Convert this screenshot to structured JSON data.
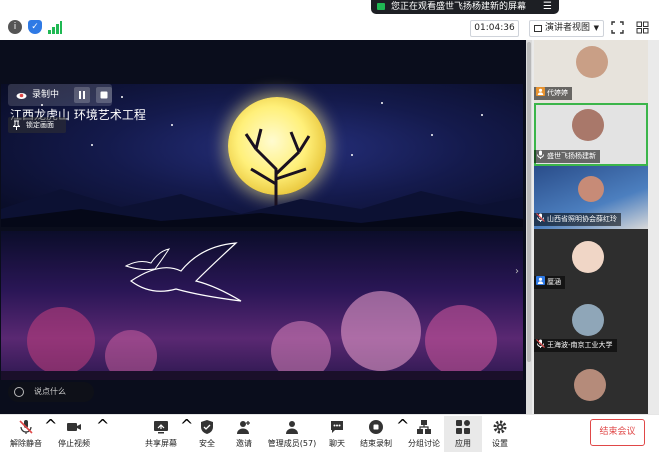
{
  "notification": {
    "text": "您正在观看盛世飞扬杨建新的屏幕",
    "icon": "video-camera-icon",
    "menu_icon": "menu-icon"
  },
  "topbar": {
    "timer": "01:04:36",
    "view_label": "演讲者视图",
    "icons": [
      "info-icon",
      "shield-icon",
      "signal-icon",
      "fullscreen-icon",
      "grid-icon"
    ]
  },
  "recording": {
    "label": "录制中",
    "pause_icon": "pause-icon",
    "stop_icon": "stop-icon"
  },
  "lock": {
    "label": "锁定画面"
  },
  "shared_screen": {
    "title": "江西龙虎山 环境艺术工程"
  },
  "comment": {
    "placeholder": "说点什么"
  },
  "participants": [
    {
      "name": "代婷婷",
      "active": false,
      "icon": "user-icon",
      "accent": "#e8932f"
    },
    {
      "name": "盛世飞扬杨建新",
      "active": true,
      "icon": "mic-icon",
      "accent": "#3bb54a"
    },
    {
      "name": "山西省照明协会薛红玲",
      "active": false,
      "icon": "muted-mic-icon",
      "accent": "#e04848"
    },
    {
      "name": "厘涵",
      "active": false,
      "icon": "user-icon",
      "accent": "#2f7ae5"
    },
    {
      "name": "王海波-南京工业大学",
      "active": false,
      "icon": "muted-mic-icon",
      "accent": "#e04848"
    }
  ],
  "toolbar": {
    "mute": "解除静音",
    "video": "停止视频",
    "share": "共享屏幕",
    "security": "安全",
    "invite": "邀请",
    "members": "管理成员(57)",
    "chat": "聊天",
    "end_record": "结束录制",
    "breakout": "分组讨论",
    "apps": "应用",
    "settings": "设置",
    "end_meeting": "结束会议"
  },
  "colors": {
    "accent_green": "#1fb853",
    "active_border": "#3bb54a",
    "end_red": "#e04848",
    "shield_blue": "#2f7ae5"
  }
}
